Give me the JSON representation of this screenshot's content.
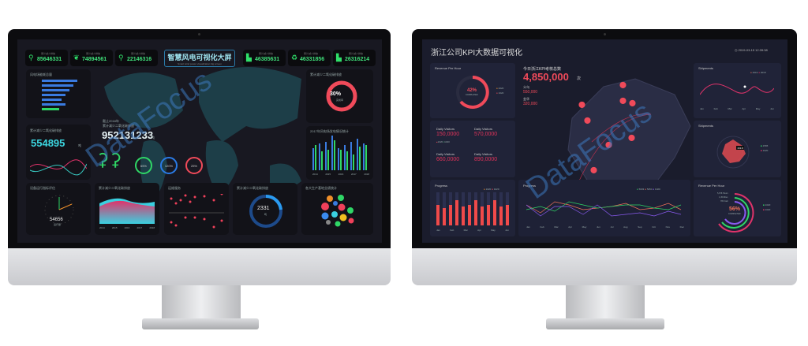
{
  "watermark": "DataFocus",
  "left_dashboard": {
    "title": "智慧风电可视化大屏",
    "subtitle": "Smart wind power visualization big screen",
    "chips": [
      {
        "icon": "wind-turbine-icon",
        "value": "85646331",
        "unit": "吨",
        "label": "累计减少排放"
      },
      {
        "icon": "leaf-icon",
        "value": "74894561",
        "unit": "吨",
        "label": "累计减少排放"
      },
      {
        "icon": "wind-turbine-icon",
        "value": "22146316",
        "unit": "吨",
        "label": "累计减少排放"
      },
      {
        "icon": "factory-icon",
        "value": "46385631",
        "unit": "吨",
        "label": "累计减少排放"
      },
      {
        "icon": "recycle-icon",
        "value": "46331856",
        "unit": "吨",
        "label": "累计减少排放"
      },
      {
        "icon": "factory-icon",
        "value": "26316214",
        "unit": "吨",
        "label": "累计减少排放"
      }
    ],
    "panel_bars_title": "风电场能耗总量",
    "panel_co2_title": "累计减少二氧化碳排放",
    "panel_co2_value": "554895",
    "panel_co2_unit": "吨",
    "center_caption1": "截止2018年",
    "center_caption2": "累计减少二氧化碳排放",
    "center_value": "952131233",
    "center_unit": "吨",
    "rings": [
      "65%",
      "120%",
      "25%"
    ],
    "right_ring_title": "累计减少二氧化碳排放",
    "right_ring_value": "30%",
    "right_ring_sub": "完成率",
    "bars_title": "2017年风电场发电情况统计",
    "bars_years": [
      "2014",
      "2015",
      "2016",
      "2017",
      "2018"
    ],
    "bottom": [
      {
        "title": "设备运行指标评估",
        "value": "54656",
        "sub": "运行量"
      },
      {
        "title": "累计减少二氧化碳排放",
        "years": [
          "2014",
          "2015",
          "2016",
          "2017",
          "2018"
        ]
      },
      {
        "title": "运维服务"
      },
      {
        "title": "累计减少二氧化碳排放",
        "value": "2331",
        "sub": "吨"
      },
      {
        "title": "各大生产基地业绩统计"
      }
    ]
  },
  "right_dashboard": {
    "title": "浙江公司KPI大数据可视化",
    "datetime": "2019-03-15 12:39:38",
    "revenue": {
      "title": "Revenue Per Hour",
      "percent": "42%",
      "sub": "COMPLETED",
      "legend": [
        "2020",
        "1020"
      ]
    },
    "kpi": {
      "title": "今日浙江KPI考核总数",
      "value": "4,850,000",
      "unit": "次",
      "items": [
        {
          "label": "义乌",
          "value": "550,000"
        },
        {
          "label": "金华",
          "value": "320,000"
        }
      ]
    },
    "shipments1": {
      "title": "Shipments",
      "legend": [
        "2019",
        "2018"
      ],
      "months": [
        "Jan",
        "Feb",
        "Mar",
        "Apr",
        "May",
        "Jun"
      ]
    },
    "visitors": [
      {
        "label": "Daily Visitors",
        "value": "150,0000"
      },
      {
        "label": "Daily Visitors",
        "value": "570,0000"
      },
      {
        "label": "Daily Visitors",
        "value": "660,0000"
      },
      {
        "label": "Daily Visitors",
        "value": "890,0000"
      }
    ],
    "visitor_legend": [
      "1020",
      "1020"
    ],
    "shipments2": {
      "title": "Shipments",
      "tooltip": "163.8",
      "legend": [
        "1565",
        "1020"
      ],
      "axes": [
        "2015",
        "2016",
        "2017",
        "2018",
        "2019",
        "2020",
        "2021",
        "2022"
      ]
    },
    "progress_bars": {
      "title": "Progress",
      "legend": [
        "1020",
        "1020"
      ],
      "months": [
        "Jan",
        "Feb",
        "Mar",
        "Apr",
        "May",
        "Jun"
      ]
    },
    "progress_lines": {
      "title": "Progress",
      "legend": [
        "5633",
        "5454",
        "1020"
      ],
      "months": [
        "Jan",
        "Feb",
        "Mar",
        "Apr",
        "May",
        "Jun",
        "Jul",
        "Aug",
        "Sep",
        "Oct",
        "Nov",
        "Dec"
      ]
    },
    "revenue2": {
      "title": "Revenue Per Hour",
      "percent": "56%",
      "sub": "COMPLETED",
      "labels": [
        "5,678 Hours",
        "1,45 Miles",
        "780 Calc"
      ],
      "legend": [
        "1020",
        "1020"
      ]
    }
  }
}
